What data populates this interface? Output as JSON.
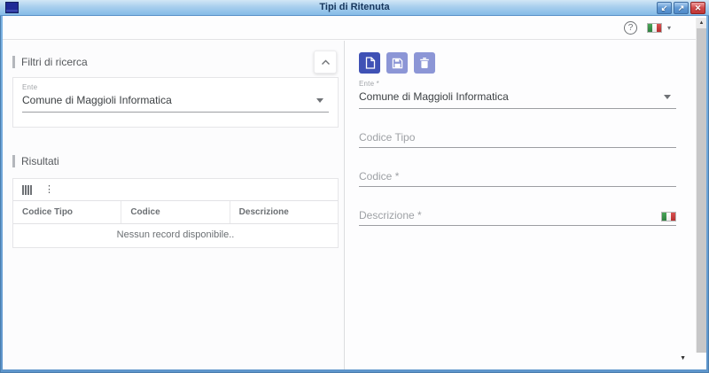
{
  "window": {
    "title": "Tipi di Ritenuta",
    "controls": {
      "restore_glyph": "↙",
      "maximize_glyph": "↗",
      "close_glyph": "✕"
    }
  },
  "header": {
    "help_glyph": "?",
    "language_caret_glyph": "▾",
    "language_flag_icon": "italian-flag"
  },
  "filters": {
    "section_title": "Filtri di ricerca",
    "ente": {
      "label": "Ente",
      "value": "Comune di Maggioli Informatica"
    }
  },
  "results": {
    "section_title": "Risultati",
    "toolbar": {
      "columns_icon": "columns",
      "menu_glyph": "⋮"
    },
    "columns": [
      "Codice Tipo",
      "Codice",
      "Descrizione"
    ],
    "empty_text": "Nessun record disponibile.."
  },
  "detail": {
    "toolbar": {
      "new_icon": "new-document",
      "save_icon": "save-floppy",
      "delete_icon": "trash"
    },
    "ente": {
      "label": "Ente *",
      "value": "Comune di Maggioli Informatica"
    },
    "codice_tipo": {
      "label": "Codice Tipo",
      "value": ""
    },
    "codice": {
      "label": "Codice *",
      "value": ""
    },
    "descrizione": {
      "label": "Descrizione *",
      "value": "",
      "flag_icon": "italian-flag"
    }
  },
  "scrollbar": {
    "up_glyph": "▲",
    "down_glyph": "▼"
  },
  "colors": {
    "primary": "#3f51b5",
    "primary_disabled": "#8c96d6",
    "titlebar_text": "#16365c",
    "close_red": "#c03636",
    "flag_green": "#3a9948",
    "flag_red": "#c23434"
  }
}
